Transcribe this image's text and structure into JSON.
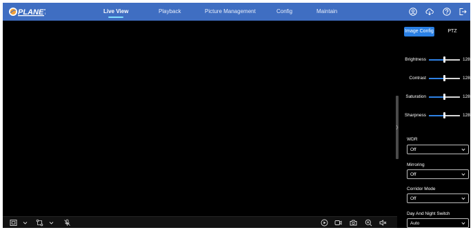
{
  "brand": {
    "name": "PLANET"
  },
  "nav": [
    {
      "label": "Live View",
      "active": true
    },
    {
      "label": "Playback",
      "active": false
    },
    {
      "label": "Picture Management",
      "active": false
    },
    {
      "label": "Config",
      "active": false
    },
    {
      "label": "Maintain",
      "active": false
    }
  ],
  "header_icons": [
    "user-icon",
    "cloud-download-icon",
    "help-icon",
    "logout-icon"
  ],
  "panel": {
    "tabs": [
      {
        "label": "Image Config",
        "active": true
      },
      {
        "label": "PTZ",
        "active": false
      }
    ],
    "sliders": [
      {
        "label": "Brightness",
        "value": "128",
        "fraction": 0.5
      },
      {
        "label": "Contrast",
        "value": "128",
        "fraction": 0.5
      },
      {
        "label": "Saturation",
        "value": "128",
        "fraction": 0.5
      },
      {
        "label": "Sharpness",
        "value": "128",
        "fraction": 0.5
      }
    ],
    "selects": [
      {
        "label": "WDR",
        "value": "Off"
      },
      {
        "label": "Mirroring",
        "value": "Off"
      },
      {
        "label": "Corridor Mode",
        "value": "Off"
      },
      {
        "label": "Day And Night Switch",
        "value": "Auto"
      }
    ]
  },
  "toolbar": {
    "left_icons": [
      "fullscreen-icon",
      "stream-select-icon",
      "microphone-muted-icon"
    ],
    "right_icons": [
      "play-icon",
      "record-icon",
      "snapshot-icon",
      "zoom-in-icon",
      "speaker-muted-icon"
    ]
  },
  "colors": {
    "header": "#3f6ec2",
    "accent": "#2a80e4",
    "nav_underline": "#7fe0ff"
  }
}
